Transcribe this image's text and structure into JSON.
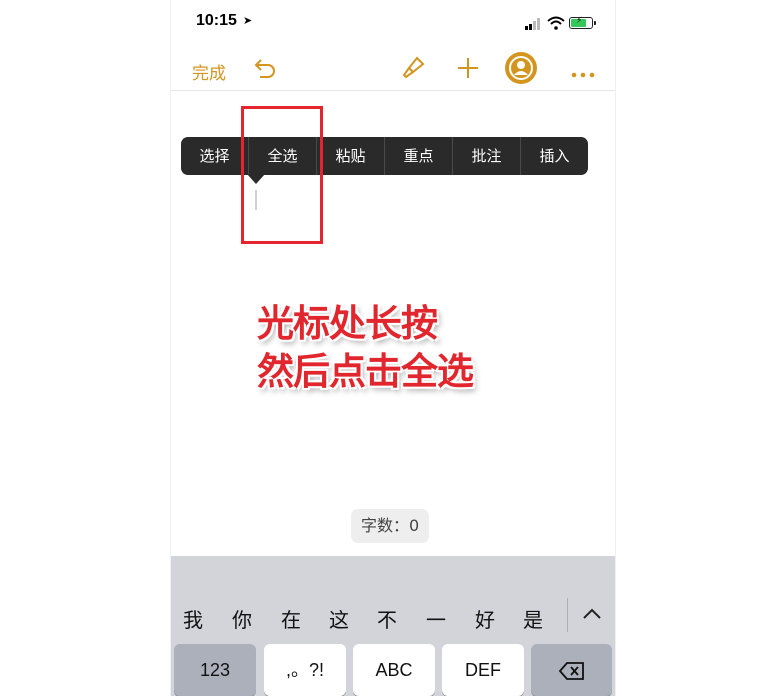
{
  "status_bar": {
    "time": "10:15",
    "location_icon": "location-arrow-icon",
    "signal_icon": "cellular-signal-icon",
    "wifi_icon": "wifi-icon",
    "battery_icon": "battery-charging-icon",
    "battery_color": "#34c759"
  },
  "toolbar": {
    "done_label": "完成",
    "undo_icon": "undo-icon",
    "brush_icon": "paintbrush-icon",
    "add_icon": "plus-icon",
    "collab_icon": "collaborate-icon",
    "more_icon": "more-icon",
    "accent": "#d4951f"
  },
  "context_menu": {
    "items": [
      "选择",
      "全选",
      "粘贴",
      "重点",
      "批注",
      "插入"
    ]
  },
  "annotation": {
    "line1": "光标处长按",
    "line2": "然后点击全选",
    "color": "#e1262d"
  },
  "word_count": "字数：0",
  "keyboard": {
    "candidates": [
      "我",
      "你",
      "在",
      "这",
      "不",
      "一",
      "好",
      "是"
    ],
    "keys": [
      "123",
      ",。?!",
      "ABC",
      "DEF"
    ],
    "delete_icon": "backspace-icon",
    "expand_icon": "chevron-up-icon"
  }
}
